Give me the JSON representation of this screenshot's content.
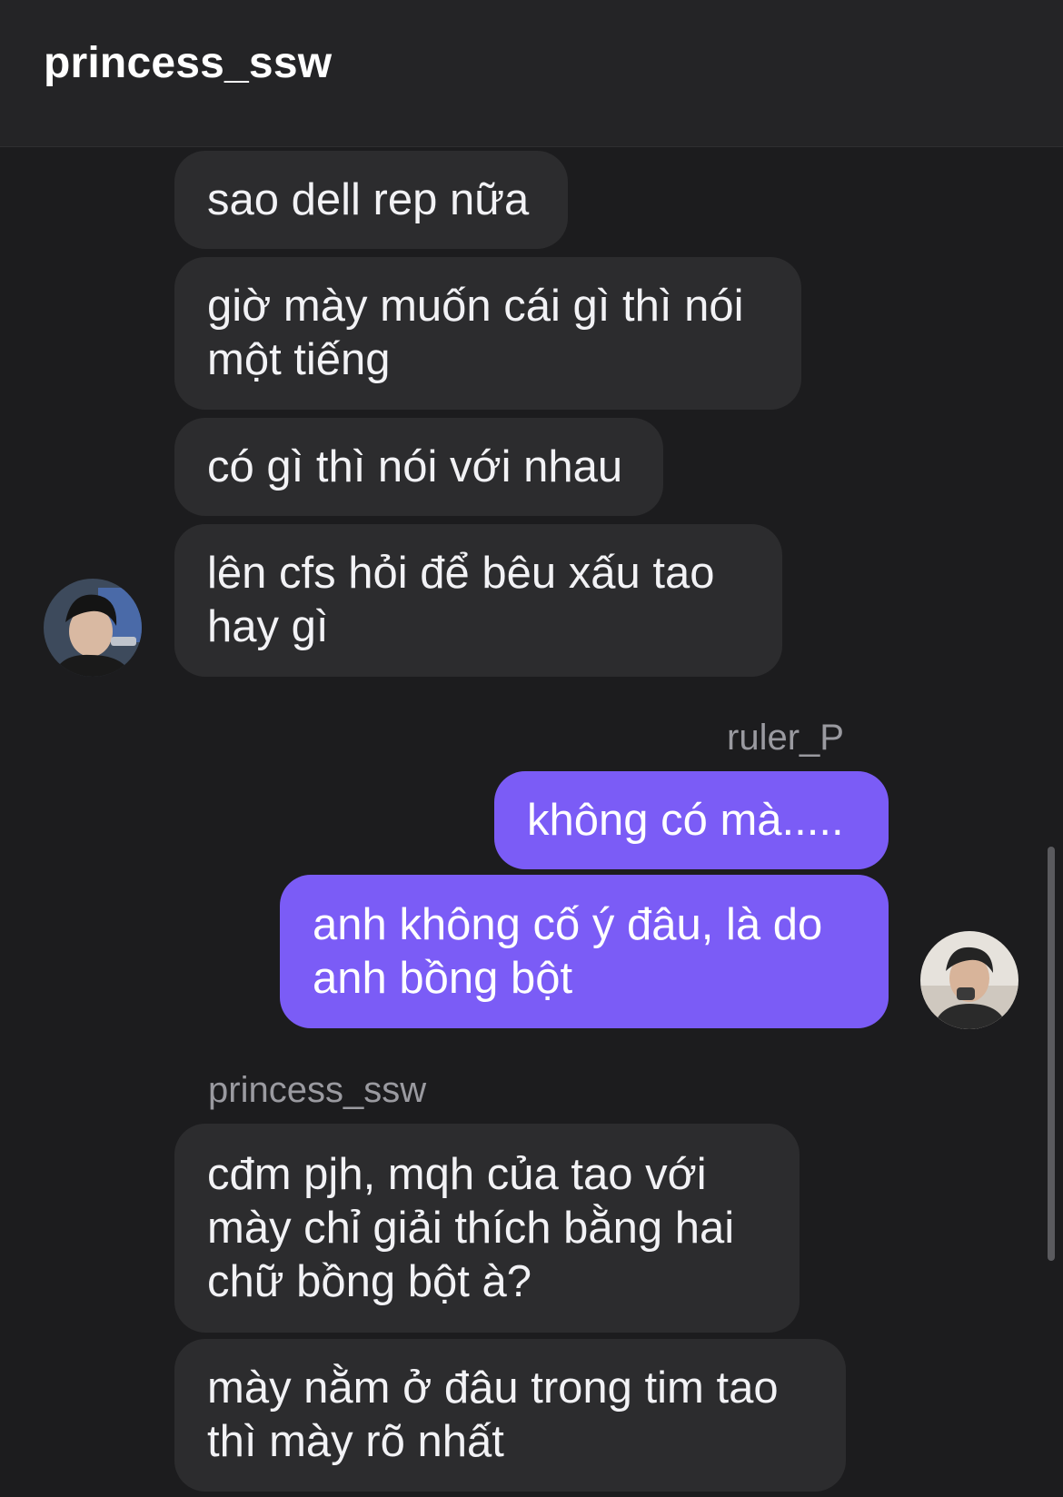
{
  "header": {
    "title": "princess_ssw"
  },
  "conversation": {
    "other_user": "princess_ssw",
    "me": "ruler_P",
    "messages": [
      {
        "sender": "princess_ssw",
        "text": "sao dell rep nữa"
      },
      {
        "sender": "princess_ssw",
        "text": "giờ mày muốn cái gì thì nói một tiếng"
      },
      {
        "sender": "princess_ssw",
        "text": "có gì thì nói với nhau"
      },
      {
        "sender": "princess_ssw",
        "text": "lên cfs hỏi để bêu xấu tao hay gì"
      },
      {
        "sender": "ruler_P",
        "text": "không có mà....."
      },
      {
        "sender": "ruler_P",
        "text": "anh không cố ý đâu, là do anh bồng bột"
      },
      {
        "sender": "princess_ssw",
        "text": "cđm pjh, mqh của tao với mày chỉ giải thích bằng hai chữ bồng bột à?"
      },
      {
        "sender": "princess_ssw",
        "text": "mày nằm ở đâu trong tim tao thì mày rõ nhất"
      }
    ]
  },
  "colors": {
    "background": "#1c1c1e",
    "incoming_bubble": "#2c2c2e",
    "outgoing_bubble": "#7b5cf6",
    "sender_label": "#9a9aa0"
  }
}
